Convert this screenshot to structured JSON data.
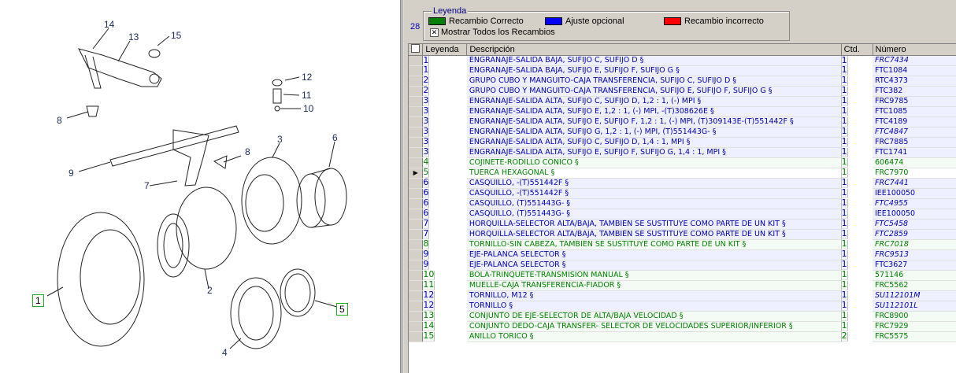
{
  "diagram": {
    "callouts": [
      "14",
      "13",
      "15",
      "12",
      "11",
      "10",
      "8",
      "8",
      "9",
      "7",
      "3",
      "6",
      "1",
      "2",
      "5",
      "4"
    ]
  },
  "panel": {
    "page_number": "28",
    "legend": {
      "title": "Leyenda",
      "correct": {
        "label": "Recambio Correcto",
        "color": "#008000"
      },
      "optional": {
        "label": "Ajuste opcional",
        "color": "#0000ff"
      },
      "incorrect": {
        "label": "Recambio incorrecto",
        "color": "#ff0000"
      },
      "show_all": {
        "label": "Mostrar Todos los Recambios",
        "checked": "✕"
      }
    },
    "table": {
      "headers": {
        "select": "",
        "legend": "Leyenda",
        "description": "Descripción",
        "qty": "Ctd.",
        "number": "Número"
      },
      "rows": [
        {
          "legend": "1",
          "description": "ENGRANAJE-SALIDA BAJA, SUFIJO C, SUFIJO D §",
          "qty": "1",
          "number": "FRC7434",
          "status": "optional",
          "italic": true
        },
        {
          "legend": "1",
          "description": "ENGRANAJE-SALIDA BAJA, SUFIJO E, SUFIJO F, SUFIJO G §",
          "qty": "1",
          "number": "FTC1084",
          "status": "optional",
          "italic": false
        },
        {
          "legend": "2",
          "description": "GRUPO CUBO Y MANGUITO-CAJA TRANSFERENCIA, SUFIJO C, SUFIJO D §",
          "qty": "1",
          "number": "RTC4373",
          "status": "optional",
          "italic": false
        },
        {
          "legend": "2",
          "description": "GRUPO CUBO Y MANGUITO-CAJA TRANSFERENCIA, SUFIJO E, SUFIJO F, SUFIJO G §",
          "qty": "1",
          "number": "FTC382",
          "status": "optional",
          "italic": false
        },
        {
          "legend": "3",
          "description": "ENGRANAJE-SALIDA ALTA, SUFIJO C, SUFIJO D, 1,2 : 1, (-) MPI §",
          "qty": "1",
          "number": "FRC9785",
          "status": "optional",
          "italic": false
        },
        {
          "legend": "3",
          "description": "ENGRANAJE-SALIDA ALTA, SUFIJO E, 1,2 : 1, (-) MPI, -(T)308626E §",
          "qty": "1",
          "number": "FTC1085",
          "status": "optional",
          "italic": false
        },
        {
          "legend": "3",
          "description": "ENGRANAJE-SALIDA ALTA, SUFIJO E, SUFIJO F, 1,2 : 1, (-) MPI, (T)309143E-(T)551442F §",
          "qty": "1",
          "number": "FTC4189",
          "status": "optional",
          "italic": false
        },
        {
          "legend": "3",
          "description": "ENGRANAJE-SALIDA ALTA, SUFIJO G, 1,2 : 1, (-) MPI, (T)551443G- §",
          "qty": "1",
          "number": "FTC4847",
          "status": "optional",
          "italic": true
        },
        {
          "legend": "3",
          "description": "ENGRANAJE-SALIDA ALTA, SUFIJO C, SUFIJO D, 1,4 : 1, MPI §",
          "qty": "1",
          "number": "FRC7885",
          "status": "optional",
          "italic": false
        },
        {
          "legend": "3",
          "description": "ENGRANAJE-SALIDA ALTA, SUFIJO E, SUFIJO F, SUFIJO G, 1,4 : 1, MPI §",
          "qty": "1",
          "number": "FTC1741",
          "status": "optional",
          "italic": false
        },
        {
          "legend": "4",
          "description": "COJINETE-RODILLO CÓNICO §",
          "qty": "1",
          "number": "606474",
          "status": "correct",
          "italic": false
        },
        {
          "legend": "5",
          "description": "TUERCA HEXAGONAL §",
          "qty": "1",
          "number": "FRC7970",
          "status": "correct",
          "italic": false,
          "active": true
        },
        {
          "legend": "6",
          "description": "CASQUILLO, -(T)551442F §",
          "qty": "1",
          "number": "FRC7441",
          "status": "optional",
          "italic": true
        },
        {
          "legend": "6",
          "description": "CASQUILLO, -(T)551442F §",
          "qty": "1",
          "number": "IEE100050",
          "status": "optional",
          "italic": false
        },
        {
          "legend": "6",
          "description": "CASQUILLO, (T)551443G- §",
          "qty": "1",
          "number": "FTC4955",
          "status": "optional",
          "italic": true
        },
        {
          "legend": "6",
          "description": "CASQUILLO, (T)551443G- §",
          "qty": "1",
          "number": "IEE100050",
          "status": "optional",
          "italic": false
        },
        {
          "legend": "7",
          "description": "HORQUILLA-SELECTOR ALTA/BAJA, TAMBIÉN SE SUSTITUYE COMO PARTE DE UN KIT §",
          "qty": "1",
          "number": "FTC5458",
          "status": "optional",
          "italic": true
        },
        {
          "legend": "7",
          "description": "HORQUILLA-SELECTOR ALTA/BAJA, TAMBIÉN SE SUSTITUYE COMO PARTE DE UN KIT §",
          "qty": "1",
          "number": "FTC2859",
          "status": "optional",
          "italic": true
        },
        {
          "legend": "8",
          "description": "TORNILLO-SIN CABEZA, TAMBIÉN SE SUSTITUYE COMO PARTE DE UN KIT §",
          "qty": "1",
          "number": "FRC7018",
          "status": "correct",
          "italic": true
        },
        {
          "legend": "9",
          "description": "EJE-PALANCA SELECTOR §",
          "qty": "1",
          "number": "FRC9513",
          "status": "optional",
          "italic": true
        },
        {
          "legend": "9",
          "description": "EJE-PALANCA SELECTOR §",
          "qty": "1",
          "number": "FTC3627",
          "status": "optional",
          "italic": false
        },
        {
          "legend": "10",
          "description": "BOLA-TRINQUETE-TRANSMISIÓN MANUAL §",
          "qty": "1",
          "number": "571146",
          "status": "correct",
          "italic": false
        },
        {
          "legend": "11",
          "description": "MUELLE-CAJA TRANSFERENCIA-FIADOR §",
          "qty": "1",
          "number": "FRC5562",
          "status": "correct",
          "italic": false
        },
        {
          "legend": "12",
          "description": "TORNILLO, M12 §",
          "qty": "1",
          "number": "SU112101M",
          "status": "optional",
          "italic": true
        },
        {
          "legend": "12",
          "description": "TORNILLO §",
          "qty": "1",
          "number": "SU112101L",
          "status": "optional",
          "italic": true
        },
        {
          "legend": "13",
          "description": "CONJUNTO DE EJE-SELECTOR DE ALTA/BAJA VELOCIDAD §",
          "qty": "1",
          "number": "FRC8900",
          "status": "correct",
          "italic": false
        },
        {
          "legend": "14",
          "description": "CONJUNTO DEDO-CAJA TRANSFER- SELECTOR DE VELOCIDADES SUPERIOR/INFERIOR §",
          "qty": "1",
          "number": "FRC7929",
          "status": "correct",
          "italic": false
        },
        {
          "legend": "15",
          "description": "ANILLO TÓRICO §",
          "qty": "2",
          "number": "FRC5575",
          "status": "correct",
          "italic": false
        }
      ],
      "row_pointer": "▶"
    }
  }
}
